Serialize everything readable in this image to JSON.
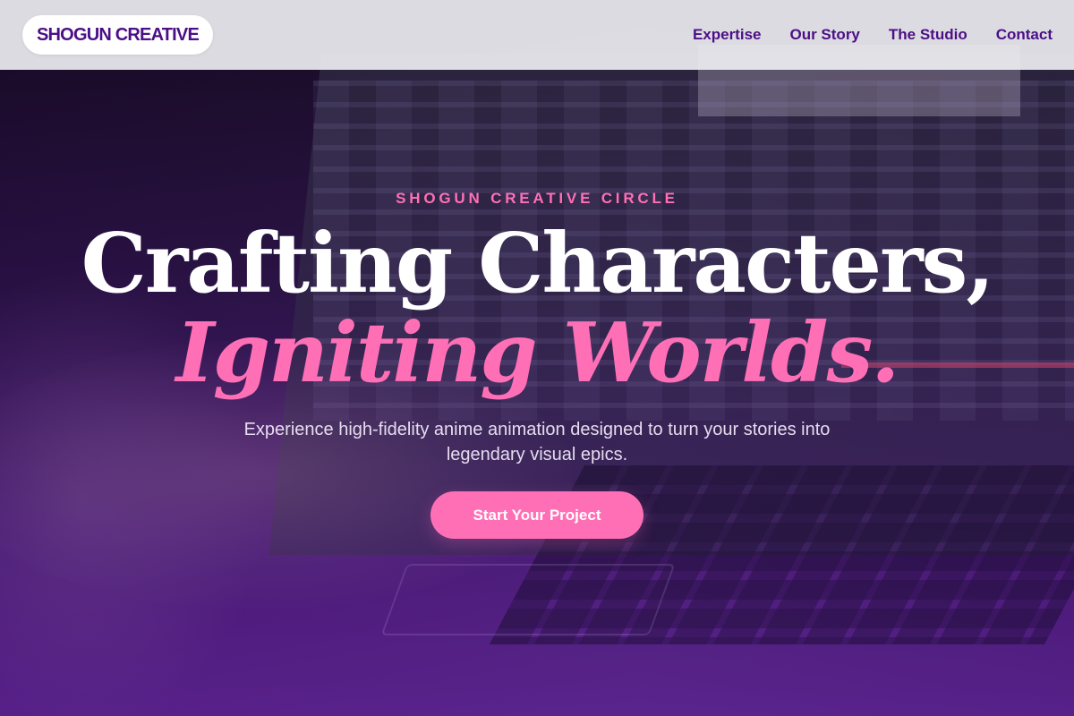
{
  "header": {
    "logo": "SHOGUN CREATIVE",
    "nav": [
      {
        "label": "Expertise"
      },
      {
        "label": "Our Story"
      },
      {
        "label": "The Studio"
      },
      {
        "label": "Contact"
      }
    ]
  },
  "hero": {
    "eyebrow": "SHOGUN CREATIVE CIRCLE",
    "headline_line1": "Crafting Characters,",
    "headline_line2": "Igniting Worlds.",
    "subtitle": "Experience high-fidelity anime animation designed to turn your stories into legendary visual epics.",
    "cta_label": "Start Your Project"
  },
  "colors": {
    "brand_purple": "#4b0f86",
    "accent_pink": "#ff6fb6",
    "header_bg": "#ececf0",
    "hero_overlay_bottom": "#5c2094"
  }
}
